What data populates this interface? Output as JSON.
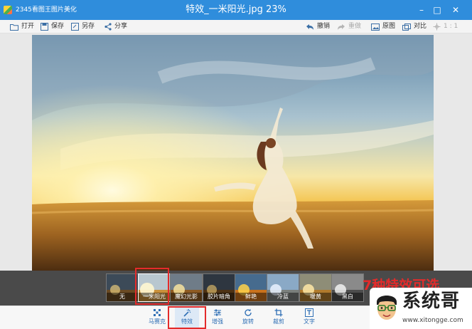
{
  "app": {
    "name": "2345看图王图片美化",
    "title": "特效_一米阳光.jpg 23%"
  },
  "window_controls": {
    "minimize": "–",
    "maximize": "□",
    "close": "✕"
  },
  "toolbar": {
    "open": "打开",
    "save": "保存",
    "save_as": "另存",
    "share": "分享",
    "undo": "撤销",
    "redo": "重做",
    "original": "原图",
    "compare": "对比",
    "zoom": "1 : 1"
  },
  "filters": [
    {
      "label": "无"
    },
    {
      "label": "一米阳光",
      "selected": true
    },
    {
      "label": "魔幻光影"
    },
    {
      "label": "胶片暗角"
    },
    {
      "label": "鲜艳"
    },
    {
      "label": "冷蓝"
    },
    {
      "label": "暖黄"
    },
    {
      "label": "黑白"
    }
  ],
  "promo_text": "7种特效可选",
  "bottom_tools": {
    "mosaic": "马赛克",
    "effects": "特效",
    "enhance": "增强",
    "rotate": "旋转",
    "crop": "裁剪",
    "text": "文字"
  },
  "watermark": {
    "name": "系统哥",
    "url": "www.xitongge.com"
  },
  "colors": {
    "titlebar": "#2f8ddc",
    "highlight": "#e32b2b",
    "accent": "#2f6fb5"
  }
}
